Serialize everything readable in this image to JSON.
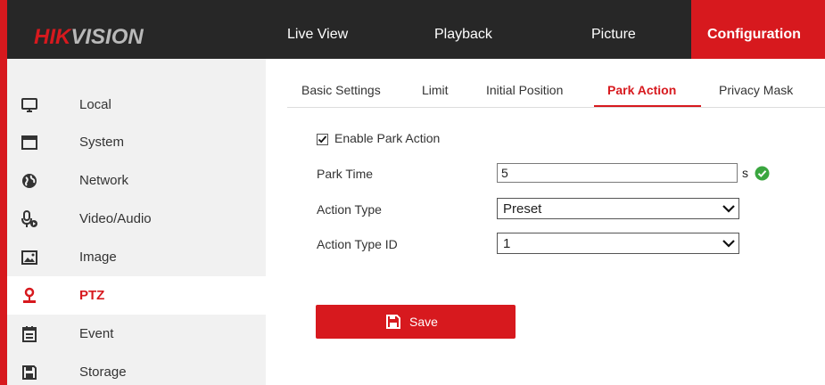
{
  "header": {
    "logo_red": "HIK",
    "logo_gray": "VISION",
    "nav": [
      "Live View",
      "Playback",
      "Picture",
      "Configuration"
    ]
  },
  "sidebar": {
    "items": [
      {
        "label": "Local",
        "icon": "monitor-icon"
      },
      {
        "label": "System",
        "icon": "system-icon"
      },
      {
        "label": "Network",
        "icon": "globe-icon"
      },
      {
        "label": "Video/Audio",
        "icon": "microphone-icon"
      },
      {
        "label": "Image",
        "icon": "image-icon"
      },
      {
        "label": "PTZ",
        "icon": "ptz-camera-icon",
        "active": true
      },
      {
        "label": "Event",
        "icon": "calendar-icon"
      },
      {
        "label": "Storage",
        "icon": "floppy-icon"
      }
    ]
  },
  "tabs": [
    "Basic Settings",
    "Limit",
    "Initial Position",
    "Park Action",
    "Privacy Mask"
  ],
  "active_tab": "Park Action",
  "form": {
    "enable_label": "Enable Park Action",
    "enable_checked": true,
    "park_time_label": "Park Time",
    "park_time_value": "5",
    "park_time_unit": "s",
    "action_type_label": "Action Type",
    "action_type_value": "Preset",
    "action_type_id_label": "Action Type ID",
    "action_type_id_value": "1"
  },
  "save_label": "Save",
  "colors": {
    "accent": "#d7191e",
    "header_bg": "#272727",
    "sidebar_bg": "#f1f1f1",
    "valid": "#3aa63f"
  }
}
